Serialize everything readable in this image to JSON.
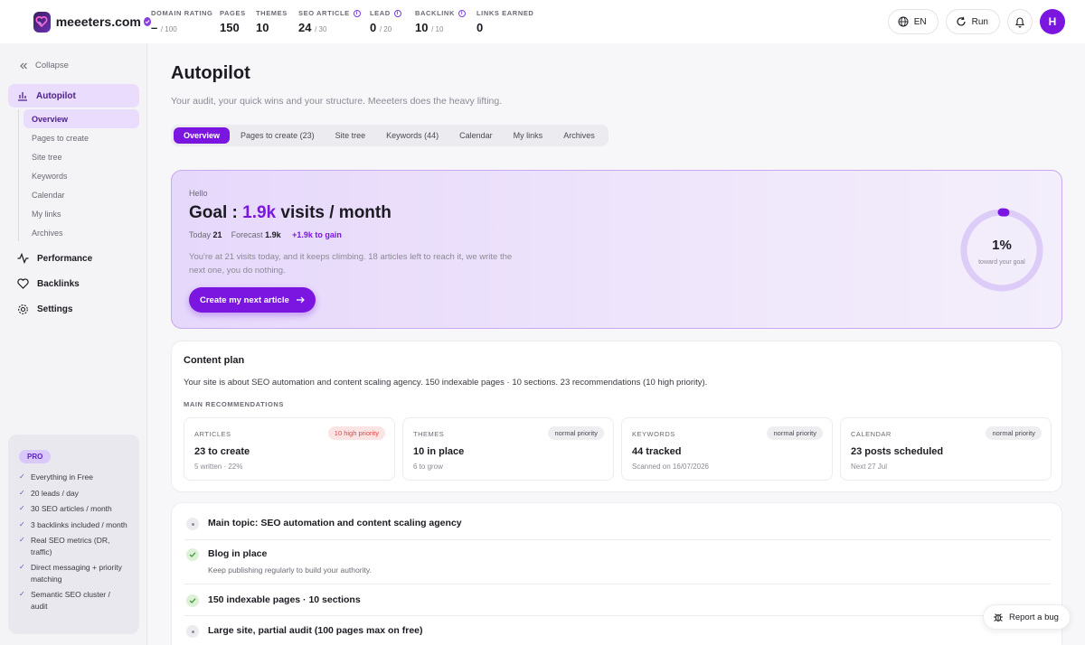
{
  "brand": {
    "name": "meeeters.com"
  },
  "stats": [
    {
      "label": "DOMAIN RATING",
      "value": "–",
      "sub": "/ 100",
      "info": false
    },
    {
      "label": "PAGES",
      "value": "150",
      "sub": "",
      "info": false
    },
    {
      "label": "THEMES",
      "value": "10",
      "sub": "",
      "info": false
    },
    {
      "label": "SEO ARTICLE",
      "value": "24",
      "sub": "/ 30",
      "info": true
    },
    {
      "label": "LEAD",
      "value": "0",
      "sub": "/ 20",
      "info": true
    },
    {
      "label": "BACKLINK",
      "value": "10",
      "sub": "/ 10",
      "info": true
    },
    {
      "label": "LINKS EARNED",
      "value": "0",
      "sub": "",
      "info": false
    }
  ],
  "top_actions": {
    "language": "EN",
    "run": "Run",
    "avatar": "H"
  },
  "sidebar": {
    "collapse": "Collapse",
    "autopilot": "Autopilot",
    "sub_items": [
      "Overview",
      "Pages to create",
      "Site tree",
      "Keywords",
      "Calendar",
      "My links",
      "Archives"
    ],
    "performance": "Performance",
    "backlinks": "Backlinks",
    "settings": "Settings",
    "pro": {
      "badge": "PRO",
      "items": [
        "Everything in Free",
        "20 leads / day",
        "30 SEO articles / month",
        "3 backlinks included / month",
        "Real SEO metrics (DR, traffic)",
        "Direct messaging + priority matching",
        "Semantic SEO cluster / audit"
      ]
    }
  },
  "main": {
    "title": "Autopilot",
    "subtitle": "Your audit, your quick wins and your structure. Meeeters does the heavy lifting.",
    "tabs": [
      "Overview",
      "Pages to create (23)",
      "Site tree",
      "Keywords (44)",
      "Calendar",
      "My links",
      "Archives"
    ]
  },
  "hero": {
    "hello": "Hello",
    "goal_prefix": "Goal : ",
    "goal_value": "1.9k",
    "goal_suffix": " visits / month",
    "today_label": "Today",
    "today_value": "21",
    "forecast_label": "Forecast",
    "forecast_value": "1.9k",
    "gain": "+1.9k to gain",
    "description": "You're at 21 visits today, and it keeps climbing. 18 articles left to reach it, we write the next one, you do nothing.",
    "cta": "Create my next article",
    "gauge_percent": "1%",
    "gauge_label": "toward your goal",
    "gauge_fraction": 0.01
  },
  "plan": {
    "title": "Content plan",
    "description": "Your site is about SEO automation and content scaling agency. 150 indexable pages · 10 sections. 23 recommendations (10 high priority).",
    "section_label": "MAIN RECOMMENDATIONS",
    "cards": [
      {
        "label": "ARTICLES",
        "badge": "10 high priority",
        "value": "23 to create",
        "sub": "5 written · 22%"
      },
      {
        "label": "THEMES",
        "badge": "normal priority",
        "value": "10 in place",
        "sub": "6 to grow"
      },
      {
        "label": "KEYWORDS",
        "badge": "normal priority",
        "value": "44 tracked",
        "sub": "Scanned on 16/07/2026"
      },
      {
        "label": "CALENDAR",
        "badge": "normal priority",
        "value": "23 posts scheduled",
        "sub": "Next 27 Jul"
      }
    ]
  },
  "checklist": [
    {
      "title": "Main topic: SEO automation and content scaling agency",
      "sub": "",
      "status": "neutral"
    },
    {
      "title": "Blog in place",
      "sub": "Keep publishing regularly to build your authority.",
      "status": "ok"
    },
    {
      "title": "150 indexable pages · 10 sections",
      "sub": "",
      "status": "ok"
    },
    {
      "title": "Large site, partial audit (100 pages max on free)",
      "sub": "",
      "status": "neutral"
    }
  ],
  "report_bug": "Report a bug",
  "colors": {
    "accent": "#7a16e0",
    "accent_light": "#eadcfd",
    "high_priority": "#e04545",
    "ok": "#4caf50"
  }
}
